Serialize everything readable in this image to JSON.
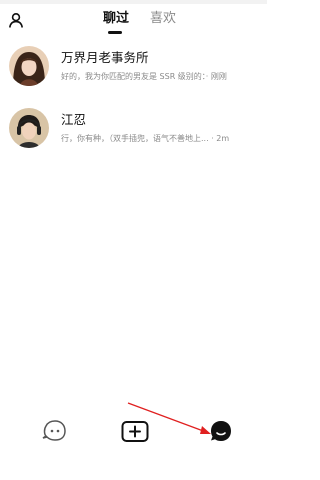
{
  "header": {
    "profile_icon": "person-outline-icon",
    "tabs": [
      {
        "label": "聊过",
        "active": true
      },
      {
        "label": "喜欢",
        "active": false
      }
    ]
  },
  "chats": [
    {
      "name": "万界月老事务所",
      "preview": "好的，我为你匹配的男友是 SSR 级别的：· 刚刚",
      "avatar": "anime-woman-portrait"
    },
    {
      "name": "江忍",
      "preview": "行，你有种，（双手插兜，语气不善地上... · 2m",
      "avatar": "anime-man-with-headphones"
    }
  ],
  "bottom_nav": [
    {
      "icon": "ghost-face-icon"
    },
    {
      "icon": "plus-box-icon"
    },
    {
      "icon": "chat-bubble-icon"
    }
  ],
  "colors": {
    "primary_text": "#111111",
    "secondary_text": "#8a8a8a",
    "annotation_arrow": "#e02020"
  }
}
